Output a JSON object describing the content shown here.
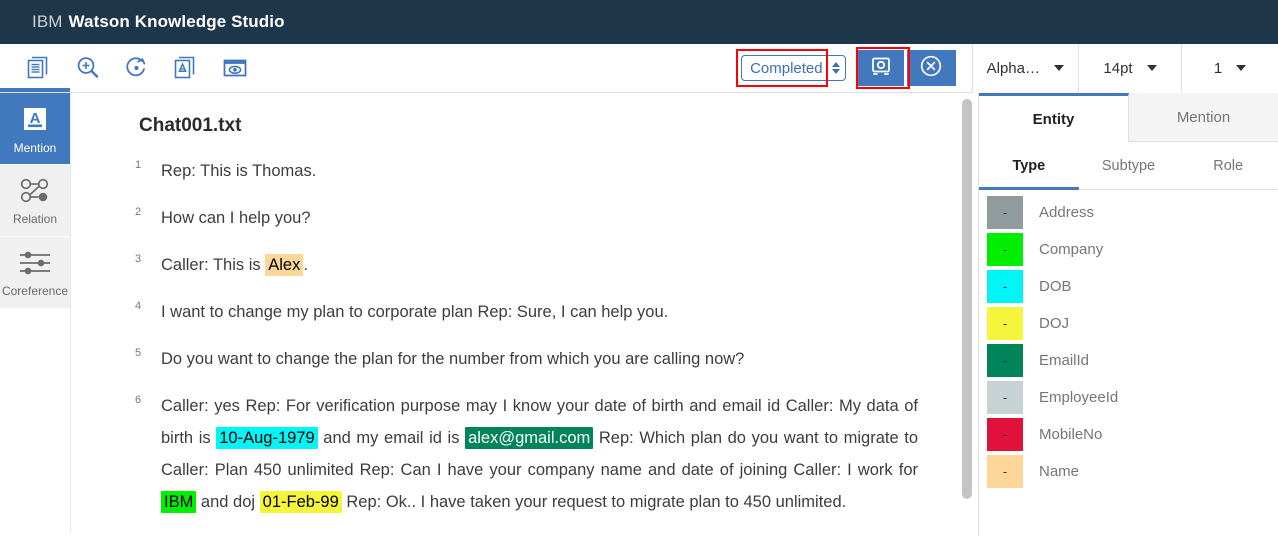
{
  "header": {
    "brand": "IBM",
    "product": "Watson Knowledge Studio"
  },
  "toolbar": {
    "icons": [
      {
        "name": "documents-icon",
        "label": "Documents"
      },
      {
        "name": "zoom-in-icon",
        "label": "Zoom in"
      },
      {
        "name": "undo-arrow-icon",
        "label": "Reset"
      },
      {
        "name": "document-annotate-icon",
        "label": "Annotate document"
      },
      {
        "name": "preview-eye-icon",
        "label": "Preview"
      }
    ],
    "status_value": "Completed",
    "save_button_label": "",
    "close_button_label": "",
    "dropdowns": [
      {
        "name": "sort-dropdown",
        "value": "Alpha…"
      },
      {
        "name": "font-size-dropdown",
        "value": "14pt"
      },
      {
        "name": "page-dropdown",
        "value": "1"
      }
    ],
    "annotation_boxes": [
      {
        "name": "status-highlight",
        "color": "#ff0000"
      },
      {
        "name": "save-highlight",
        "color": "#ff0000"
      }
    ]
  },
  "rail": {
    "items": [
      {
        "label": "Mention",
        "icon": "mention-letter-a-icon",
        "active": true
      },
      {
        "label": "Relation",
        "icon": "relation-graph-icon",
        "active": false
      },
      {
        "label": "Coreference",
        "icon": "coreference-sliders-icon",
        "active": false
      }
    ]
  },
  "document": {
    "title": "Chat001.txt",
    "lines": [
      {
        "num": "1",
        "text": "Rep: This is Thomas."
      },
      {
        "num": "2",
        "text": "How can I help you?"
      },
      {
        "num": "3",
        "text": "Caller: This is Alex."
      },
      {
        "num": "4",
        "text": "I want to change my plan to corporate plan Rep: Sure, I can help you."
      },
      {
        "num": "5",
        "text": "Do you want to change the plan for the number from which you are calling now?"
      },
      {
        "num": "6",
        "text": "Caller: yes Rep: For verification purpose may I know your date of birth and email id Caller: My data of birth is 10-Aug-1979 and my email id is alex@gmail.com Rep: Which plan do you want to migrate to Caller: Plan 450 unlimited Rep: Can I have your company name and date of joining Caller: I work for IBM and doj 01-Feb-99 Rep: Ok.. I have taken your request to migrate plan to 450 unlimited."
      }
    ],
    "line3": {
      "pre": "Caller: This is ",
      "mark": "Alex",
      "post": "."
    },
    "line6": {
      "p1": "Caller: yes Rep: For verification purpose may I know your date of birth and email id",
      "p2_pre": "Caller: My data of birth is ",
      "p2_dob": "10-Aug-1979",
      "p2_mid": " and my email id is ",
      "p2_email": "alex@gmail.com",
      "p2_post": " Rep: Which plan do you want to migrate to Caller: Plan 450 unlimited Rep: Can I have your company name and date of joining Caller: I work for ",
      "p2_company": "IBM",
      "p2_mid2": " and doj ",
      "p2_doj": "01-Feb-99",
      "p2_tail": " Rep: Ok.. I have taken your request to migrate plan to 450 unlimited."
    }
  },
  "right_panel": {
    "tabs": [
      {
        "label": "Entity",
        "active": true
      },
      {
        "label": "Mention",
        "active": false
      }
    ],
    "sub_tabs": [
      {
        "label": "Type",
        "active": true
      },
      {
        "label": "Subtype",
        "active": false
      },
      {
        "label": "Role",
        "active": false
      }
    ],
    "types": [
      {
        "label": "Address",
        "color": "#919a9d",
        "key": "-"
      },
      {
        "label": "Company",
        "color": "#00ee00",
        "key": "-"
      },
      {
        "label": "DOB",
        "color": "#00f5f5",
        "key": "-"
      },
      {
        "label": "DOJ",
        "color": "#f5f53c",
        "key": "-"
      },
      {
        "label": "EmailId",
        "color": "#00855b",
        "key": "-"
      },
      {
        "label": "EmployeeId",
        "color": "#c6d2d3",
        "key": "-"
      },
      {
        "label": "MobileNo",
        "color": "#e0123c",
        "key": "-"
      },
      {
        "label": "Name",
        "color": "#fdd79a",
        "key": "-"
      }
    ]
  },
  "highlight_colors": {
    "name": "#fdd79a",
    "dob": "#00f5f5",
    "emailid": "#00855b",
    "company": "#00ee00",
    "doj": "#f5f53c"
  },
  "scrollbar": {
    "name": "document-scrollbar"
  }
}
